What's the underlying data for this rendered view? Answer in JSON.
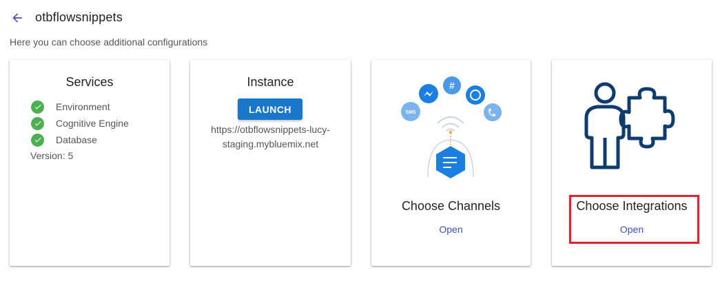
{
  "header": {
    "title": "otbflowsnippets",
    "subtitle": "Here you can choose additional configurations"
  },
  "services_card": {
    "title": "Services",
    "items": [
      {
        "label": "Environment",
        "status": "ok"
      },
      {
        "label": "Cognitive Engine",
        "status": "ok"
      },
      {
        "label": "Database",
        "status": "ok"
      }
    ],
    "version": "Version: 5"
  },
  "instance_card": {
    "title": "Instance",
    "launch_label": "LAUNCH",
    "url_line1": "https://otbflowsnippets-lucy-",
    "url_line2": "staging.mybluemix.net"
  },
  "channels_card": {
    "title": "Choose Channels",
    "open_label": "Open",
    "sms_label": "SMS"
  },
  "integrations_card": {
    "title": "Choose Integrations",
    "open_label": "Open"
  },
  "colors": {
    "accent": "#1976c8",
    "link": "#3f51b5",
    "success": "#4caf50",
    "highlight": "#e0212e",
    "integration_icon": "#0f3c6e"
  }
}
